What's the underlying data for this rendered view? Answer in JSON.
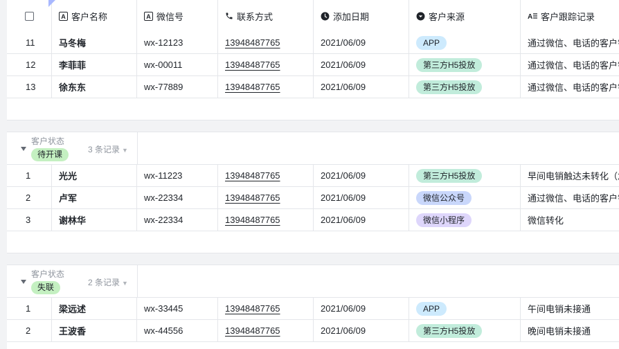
{
  "columns": {
    "name": "客户名称",
    "wechat": "微信号",
    "contact": "联系方式",
    "date": "添加日期",
    "source": "客户来源",
    "record": "客户跟踪记录"
  },
  "group_rows_top": [
    {
      "idx": "11",
      "name": "马冬梅",
      "wx": "wx-12123",
      "phone": "13948487765",
      "date": "2021/06/09",
      "source": "APP",
      "record": "通过微信、电话的客户销"
    },
    {
      "idx": "12",
      "name": "李菲菲",
      "wx": "wx-00011",
      "phone": "13948487765",
      "date": "2021/06/09",
      "source": "第三方H5投放",
      "record": "通过微信、电话的客户销"
    },
    {
      "idx": "13",
      "name": "徐东东",
      "wx": "wx-77889",
      "phone": "13948487765",
      "date": "2021/06/09",
      "source": "第三方H5投放",
      "record": "通过微信、电话的客户销"
    }
  ],
  "groups": [
    {
      "field_label": "客户状态",
      "status": "待开课",
      "count": "3 条记录",
      "rows": [
        {
          "idx": "1",
          "name": "光光",
          "wx": "wx-11223",
          "phone": "13948487765",
          "date": "2021/06/09",
          "source": "第三方H5投放",
          "record": "早间电销触达未转化（急"
        },
        {
          "idx": "2",
          "name": "卢军",
          "wx": "wx-22334",
          "phone": "13948487765",
          "date": "2021/06/09",
          "source": "微信公众号",
          "record": "通过微信、电话的客户销"
        },
        {
          "idx": "3",
          "name": "谢林华",
          "wx": "wx-22334",
          "phone": "13948487765",
          "date": "2021/06/09",
          "source": "微信小程序",
          "record": "微信转化"
        }
      ]
    },
    {
      "field_label": "客户状态",
      "status": "失联",
      "count": "2 条记录",
      "rows": [
        {
          "idx": "1",
          "name": "梁远述",
          "wx": "wx-33445",
          "phone": "13948487765",
          "date": "2021/06/09",
          "source": "APP",
          "record": "午间电销未接通"
        },
        {
          "idx": "2",
          "name": "王波香",
          "wx": "wx-44556",
          "phone": "13948487765",
          "date": "2021/06/09",
          "source": "第三方H5投放",
          "record": "晚间电销未接通"
        }
      ]
    }
  ],
  "icons": {
    "checkbox": "checkbox-icon",
    "text": "text-field-icon",
    "phone": "phone-icon",
    "clock": "clock-icon",
    "select": "single-select-icon",
    "longtext": "long-text-icon"
  }
}
